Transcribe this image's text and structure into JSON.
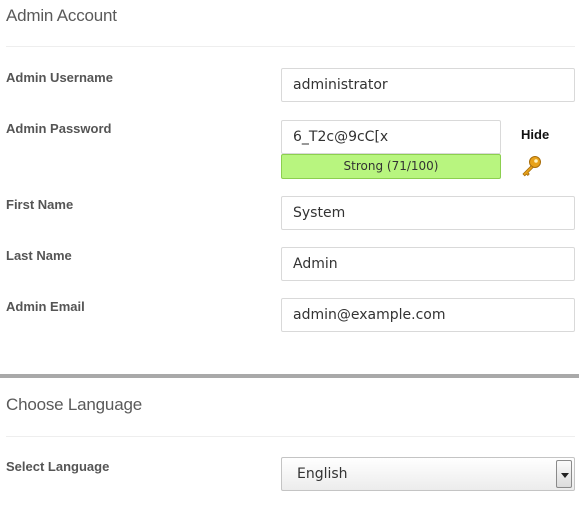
{
  "admin_section": {
    "title": "Admin Account",
    "username": {
      "label": "Admin Username",
      "value": "administrator"
    },
    "password": {
      "label": "Admin Password",
      "value": "6_T2c@9cC[x",
      "strength_text": "Strong (71/100)",
      "strength_score": 71,
      "strength_color": "#b8f57f",
      "hide_label": "Hide",
      "generate_icon": "key-icon"
    },
    "first_name": {
      "label": "First Name",
      "value": "System"
    },
    "last_name": {
      "label": "Last Name",
      "value": "Admin"
    },
    "email": {
      "label": "Admin Email",
      "value": "admin@example.com"
    }
  },
  "language_section": {
    "title": "Choose Language",
    "select_label": "Select Language",
    "selected": "English"
  }
}
